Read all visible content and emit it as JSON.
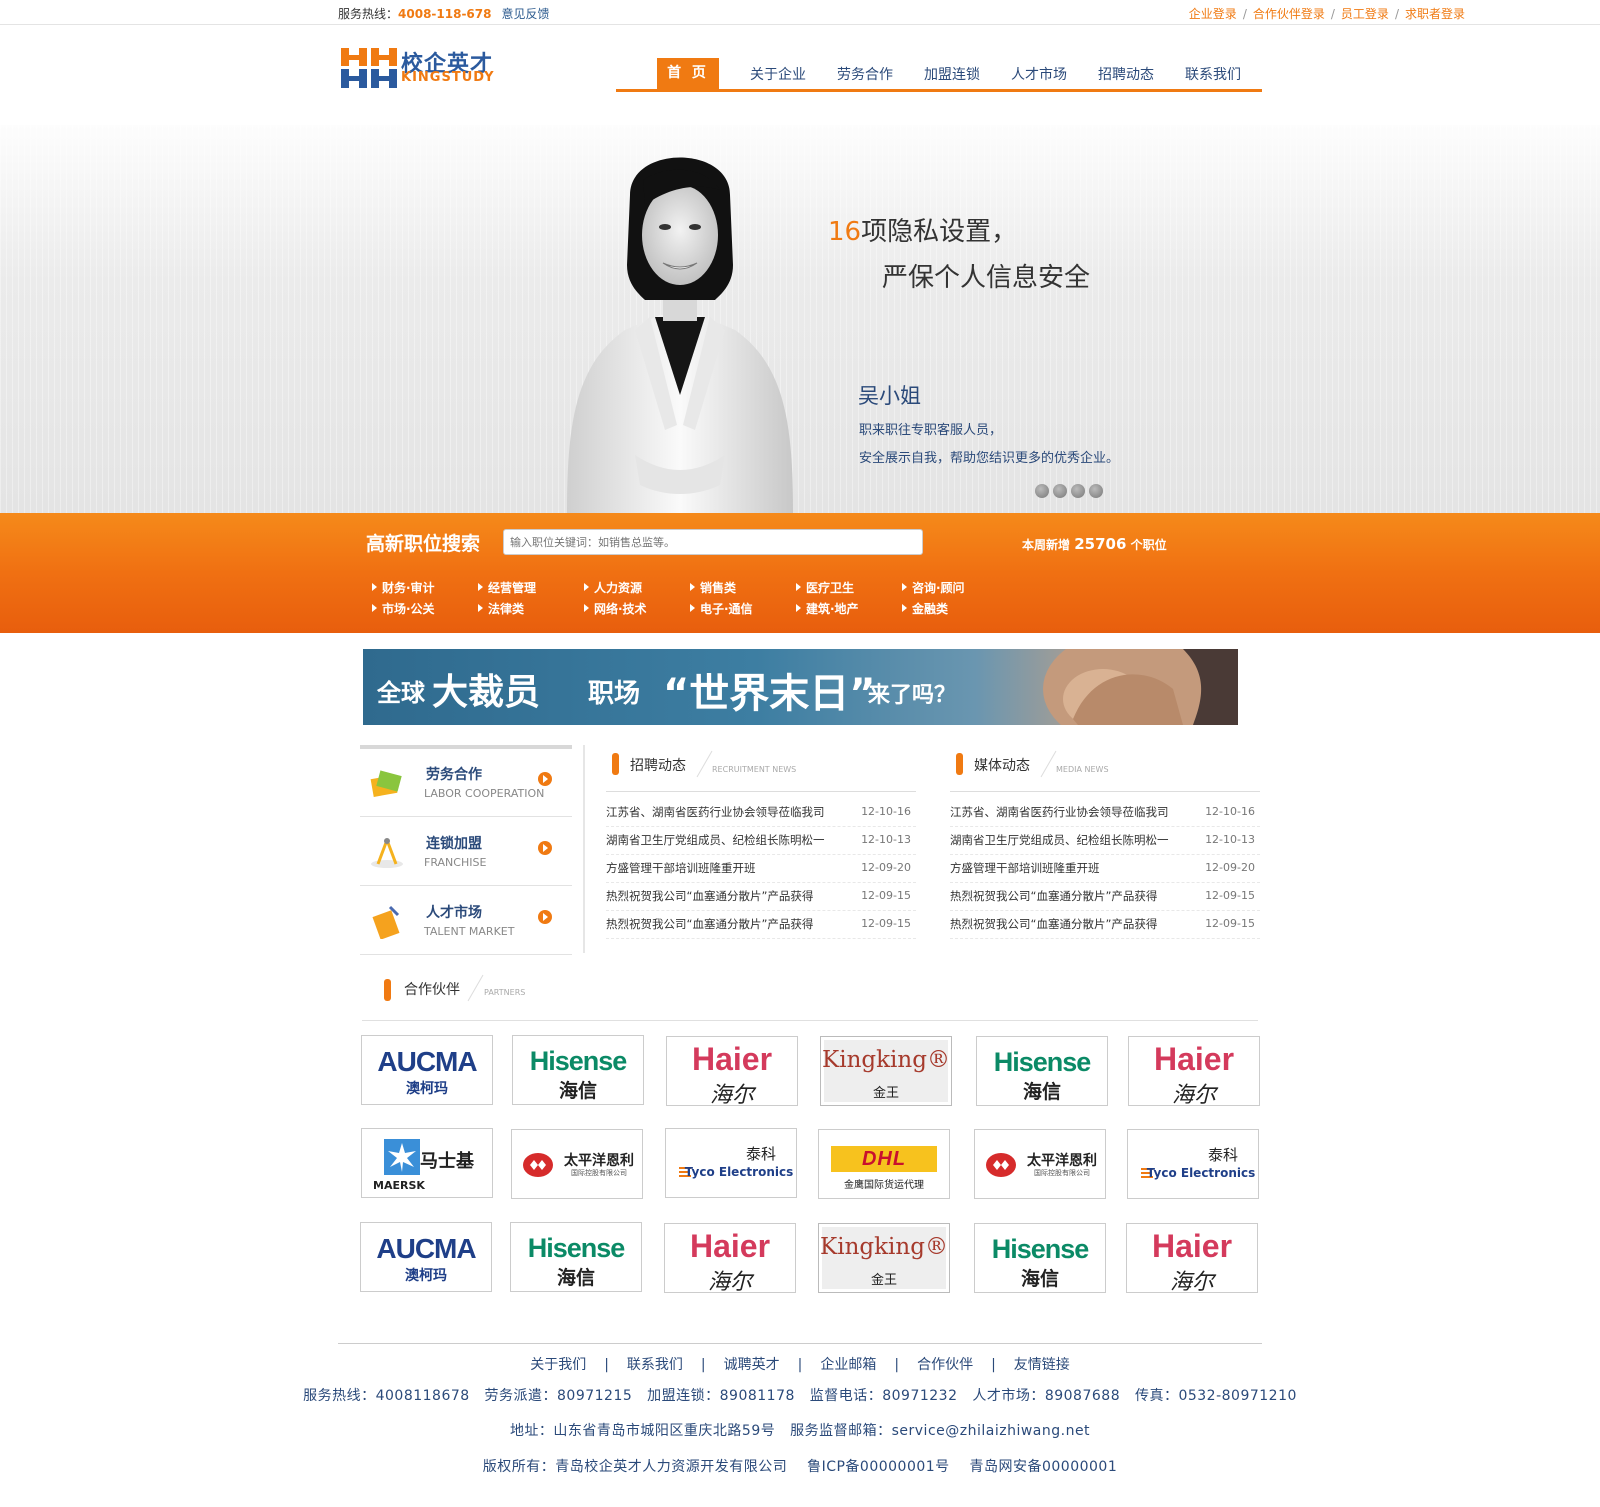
{
  "topbar": {
    "hotline_label": "服务热线：",
    "hotline_number": "4008-118-678",
    "feedback": "意见反馈",
    "logins": [
      "企业登录",
      "合作伙伴登录",
      "员工登录",
      "求职者登录"
    ],
    "login_sep": "/"
  },
  "logo": {
    "cn": "校企英才",
    "en": "KINGSTUDY"
  },
  "nav": {
    "items": [
      "首 页",
      "关于企业",
      "劳务合作",
      "加盟连锁",
      "人才市场",
      "招聘动态",
      "联系我们"
    ]
  },
  "hero": {
    "num": "16",
    "headline1": "项隐私设置，",
    "headline2": "严保个人信息安全",
    "name": "吴小姐",
    "desc1": "职来职往专职客服人员，",
    "desc2": "安全展示自我，帮助您结识更多的优秀企业。"
  },
  "search": {
    "label": "高新职位搜索",
    "placeholder": "输入职位关键词：如销售总监等。",
    "count_prefix": "本周新增",
    "count": "25706",
    "count_suffix": "个职位",
    "categories": [
      [
        "财务·审计",
        "市场·公关"
      ],
      [
        "经营管理",
        "法律类"
      ],
      [
        "人力资源",
        "网络·技术"
      ],
      [
        "销售类",
        "电子·通信"
      ],
      [
        "医疗卫生",
        "建筑·地产"
      ],
      [
        "咨询·顾问",
        "金融类"
      ]
    ]
  },
  "banner": {
    "t1": "全球",
    "t2": "大裁员",
    "t3": "职场",
    "t4": "“世界末日”",
    "t5": "来了吗？"
  },
  "side": [
    {
      "cn": "劳务合作",
      "en": "LABOR COOPERATION"
    },
    {
      "cn": "连锁加盟",
      "en": "FRANCHISE"
    },
    {
      "cn": "人才市场",
      "en": "TALENT MARKET"
    }
  ],
  "recruit": {
    "title": "招聘动态",
    "en": "RECRUITMENT NEWS",
    "items": [
      {
        "text": "江苏省、湖南省医药行业协会领导莅临我司",
        "date": "12-10-16"
      },
      {
        "text": "湖南省卫生厅党组成员、纪检组长陈明松一",
        "date": "12-10-13"
      },
      {
        "text": "方盛管理干部培训班隆重开班",
        "date": "12-09-20"
      },
      {
        "text": "热烈祝贺我公司“血塞通分散片”产品获得",
        "date": "12-09-15"
      },
      {
        "text": "热烈祝贺我公司“血塞通分散片”产品获得",
        "date": "12-09-15"
      }
    ]
  },
  "media": {
    "title": "媒体动态",
    "en": "MEDIA NEWS",
    "items": [
      {
        "text": "江苏省、湖南省医药行业协会领导莅临我司",
        "date": "12-10-16"
      },
      {
        "text": "湖南省卫生厅党组成员、纪检组长陈明松一",
        "date": "12-10-13"
      },
      {
        "text": "方盛管理干部培训班隆重开班",
        "date": "12-09-20"
      },
      {
        "text": "热烈祝贺我公司“血塞通分散片”产品获得",
        "date": "12-09-15"
      },
      {
        "text": "热烈祝贺我公司“血塞通分散片”产品获得",
        "date": "12-09-15"
      }
    ]
  },
  "partners": {
    "title": "合作伙伴",
    "en": "PARTNERS",
    "logos": {
      "aucma": {
        "a1": "AUCMA",
        "a2": "澳柯玛"
      },
      "hisense": {
        "a1": "Hisense",
        "a2": "海信"
      },
      "haier": {
        "a1": "Haier",
        "a2": "海尔"
      },
      "kingking": {
        "a1": "Kingking®",
        "a2": "金王"
      },
      "maersk": {
        "a1": "马士基",
        "a2": "MAERSK"
      },
      "pacific": {
        "a1": "太平洋恩利",
        "a2": "国际控股有限公司"
      },
      "tyco": {
        "a1": "泰科",
        "a2": "Tyco Electronics"
      },
      "dhl": {
        "a1": "DHL",
        "a2": "金鹰国际货运代理"
      }
    }
  },
  "footer": {
    "links": [
      "关于我们",
      "联系我们",
      "诚聘英才",
      "企业邮箱",
      "合作伙伴",
      "友情链接"
    ],
    "sep": "|",
    "line1": "服务热线：4008118678   劳务派遣：80971215   加盟连锁：89081178   监督电话：80971232   人才市场：89087688   传真：0532-80971210",
    "line2": "地址：山东省青岛市城阳区重庆北路59号   服务监督邮箱：service@zhilaizhiwang.net",
    "line3": "版权所有：青岛校企英才人力资源开发有限公司    鲁ICP备00000001号    青岛网安备00000001"
  },
  "colors": {
    "accent": "#f07a12",
    "nav_text": "#2b4a7a",
    "brand_blue": "#2b5a9e"
  }
}
